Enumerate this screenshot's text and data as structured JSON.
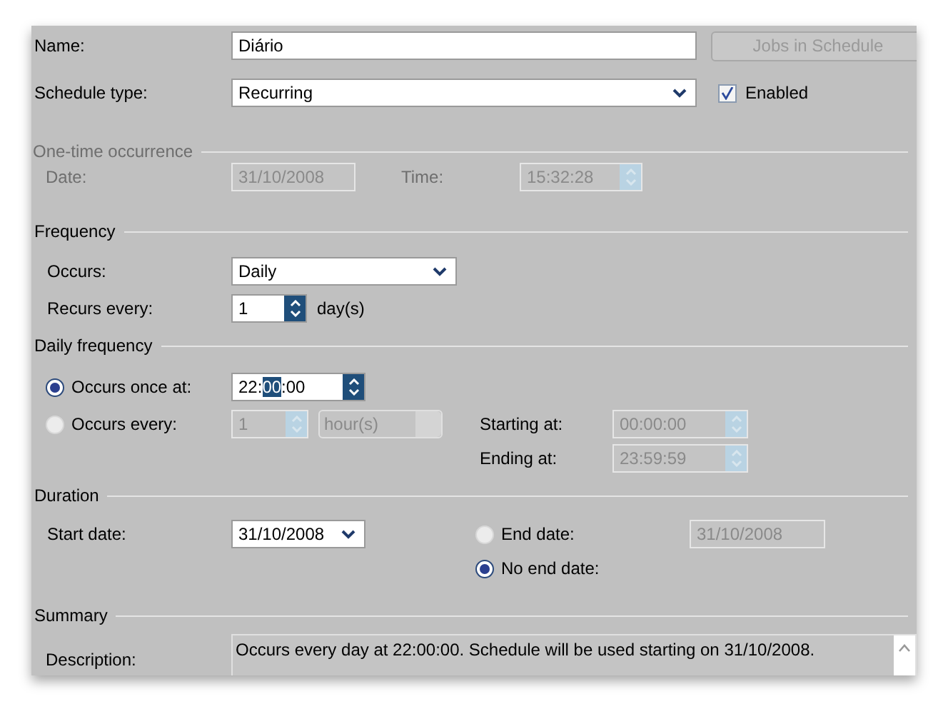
{
  "name": {
    "label": "Name:",
    "value": "Diário"
  },
  "jobs_button": {
    "label": "Jobs in Schedule",
    "disabled": true
  },
  "schedule_type": {
    "label": "Schedule type:",
    "value": "Recurring"
  },
  "enabled": {
    "label": "Enabled",
    "checked": true
  },
  "one_time": {
    "title": "One-time occurrence",
    "disabled": true,
    "date_label": "Date:",
    "date": "31/10/2008",
    "time_label": "Time:",
    "time": "15:32:28"
  },
  "frequency": {
    "title": "Frequency",
    "occurs_label": "Occurs:",
    "occurs": "Daily",
    "recurs_label": "Recurs every:",
    "recurs": "1",
    "recurs_unit": "day(s)"
  },
  "daily_frequency": {
    "title": "Daily frequency",
    "options": [
      {
        "label": "Occurs once at:",
        "selected": true
      },
      {
        "label": "Occurs every:",
        "selected": false
      }
    ],
    "once_time": {
      "before": "22:",
      "selected": "00",
      "after": ":00"
    },
    "every_value": "1",
    "every_unit": "hour(s)",
    "starting_label": "Starting at:",
    "starting": "00:00:00",
    "ending_label": "Ending at:",
    "ending": "23:59:59"
  },
  "duration": {
    "title": "Duration",
    "start_label": "Start date:",
    "start": "31/10/2008",
    "end_options": [
      {
        "label": "End date:",
        "selected": false
      },
      {
        "label": "No end date:",
        "selected": true
      }
    ],
    "end_date": "31/10/2008"
  },
  "summary": {
    "title": "Summary",
    "description_label": "Description:",
    "description": "Occurs every day at 22:00:00. Schedule will be used starting on 31/10/2008."
  }
}
